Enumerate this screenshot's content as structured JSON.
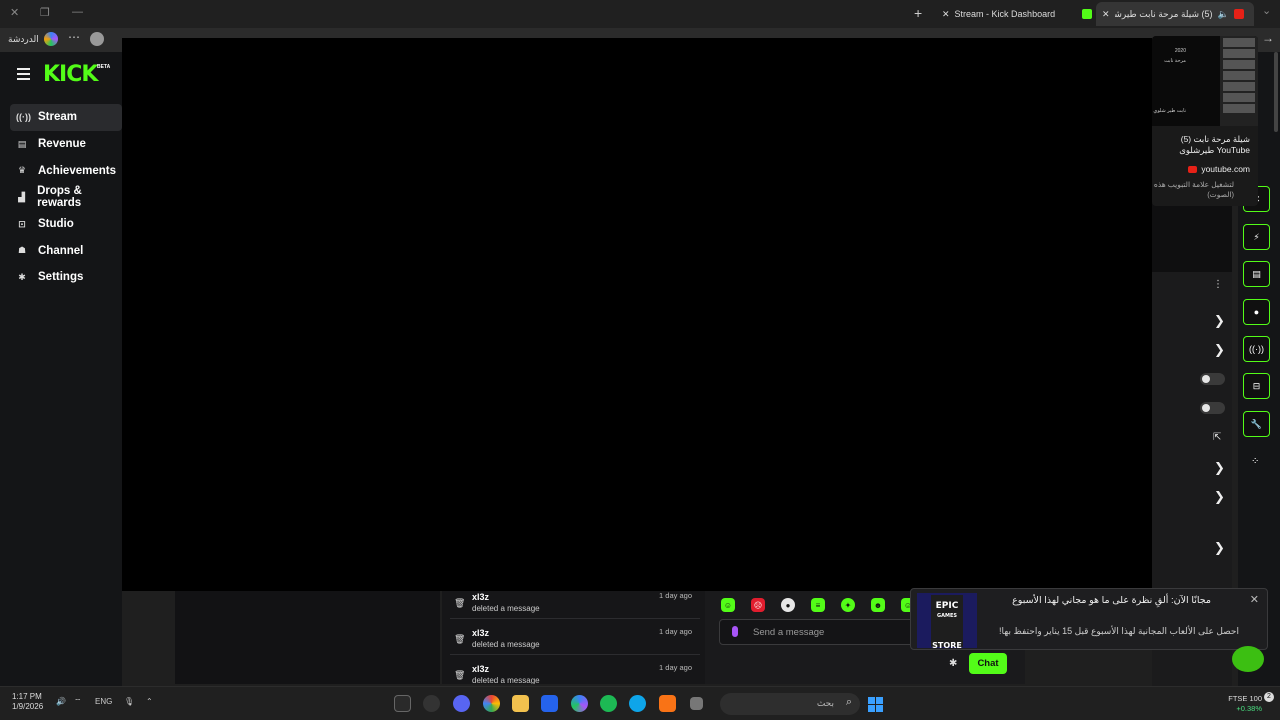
{
  "browser": {
    "tabs": [
      {
        "label": "Stream - Kick Dashboard",
        "active": false
      },
      {
        "label": "(5) شيلة مرحة نابت طيرشلوى",
        "active": true
      }
    ],
    "new_tab_symbol": "+",
    "chat_label": "الدردشة"
  },
  "sidebar": {
    "logo": "KICK",
    "logo_badge": "BETA",
    "items": [
      {
        "label": "Stream",
        "icon": "stream-icon",
        "active": true
      },
      {
        "label": "Revenue",
        "icon": "revenue-icon"
      },
      {
        "label": "Achievements",
        "icon": "trophy-icon"
      },
      {
        "label": "Drops & rewards",
        "icon": "drops-icon"
      },
      {
        "label": "Studio",
        "icon": "studio-icon"
      },
      {
        "label": "Channel",
        "icon": "channel-icon"
      },
      {
        "label": "Settings",
        "icon": "gear-icon"
      }
    ]
  },
  "tab_preview": {
    "title": "(5) شيلة مرحة نابت طيرشلوى YouTube",
    "site": "youtube.com",
    "note": "لتشغيل علامة التبويب هذه (الصوت)",
    "thumb_text": [
      "2020",
      "مرحة نابت",
      "نابت طير شلوي"
    ]
  },
  "activity": {
    "rows": [
      {
        "user": "xl3z",
        "message": "deleted a message",
        "time": "1 day ago"
      },
      {
        "user": "xl3z",
        "message": "deleted a message",
        "time": "1 day ago"
      },
      {
        "user": "xl3z",
        "message": "deleted a message",
        "time": "1 day ago"
      }
    ]
  },
  "chat": {
    "placeholder": "Send a message",
    "send_label": "Chat"
  },
  "toast": {
    "app": "Epic Games Store",
    "logo_top": "EPIC",
    "logo_mid": "GAMES",
    "logo_bottom": "STORE",
    "title": "مجانًا الآن: ألقِ نظرة على ما هو مجاني لهذا الأسبوع",
    "body": "احصل على الألعاب المجانية لهذا الأسبوع قبل 15 يناير واحتفظ بها!"
  },
  "taskbar": {
    "time": "1:17 PM",
    "date": "1/9/2026",
    "lang": "ENG",
    "search_placeholder": "بحث",
    "stock_name": "FTSE 100",
    "stock_change": "+0.38%",
    "notifications": "2"
  },
  "colors": {
    "kick_green": "#53fc18",
    "sidebar_bg": "#141517",
    "toast_bg": "#1e1e20"
  }
}
